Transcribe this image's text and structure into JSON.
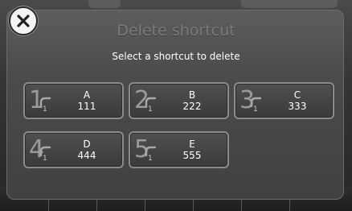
{
  "dialog": {
    "title": "Delete shortcut",
    "instruction": "Select a shortcut to delete"
  },
  "shortcuts": [
    {
      "slot": "1",
      "sub": "1",
      "name": "A",
      "number": "111"
    },
    {
      "slot": "2",
      "sub": "1",
      "name": "B",
      "number": "222"
    },
    {
      "slot": "3",
      "sub": "1",
      "name": "C",
      "number": "333"
    },
    {
      "slot": "4",
      "sub": "1",
      "name": "D",
      "number": "444"
    },
    {
      "slot": "5",
      "sub": "1",
      "name": "E",
      "number": "555"
    }
  ],
  "icons": {
    "close": "close-icon",
    "shortcut_symbol": "speed-dial-hook-icon"
  }
}
